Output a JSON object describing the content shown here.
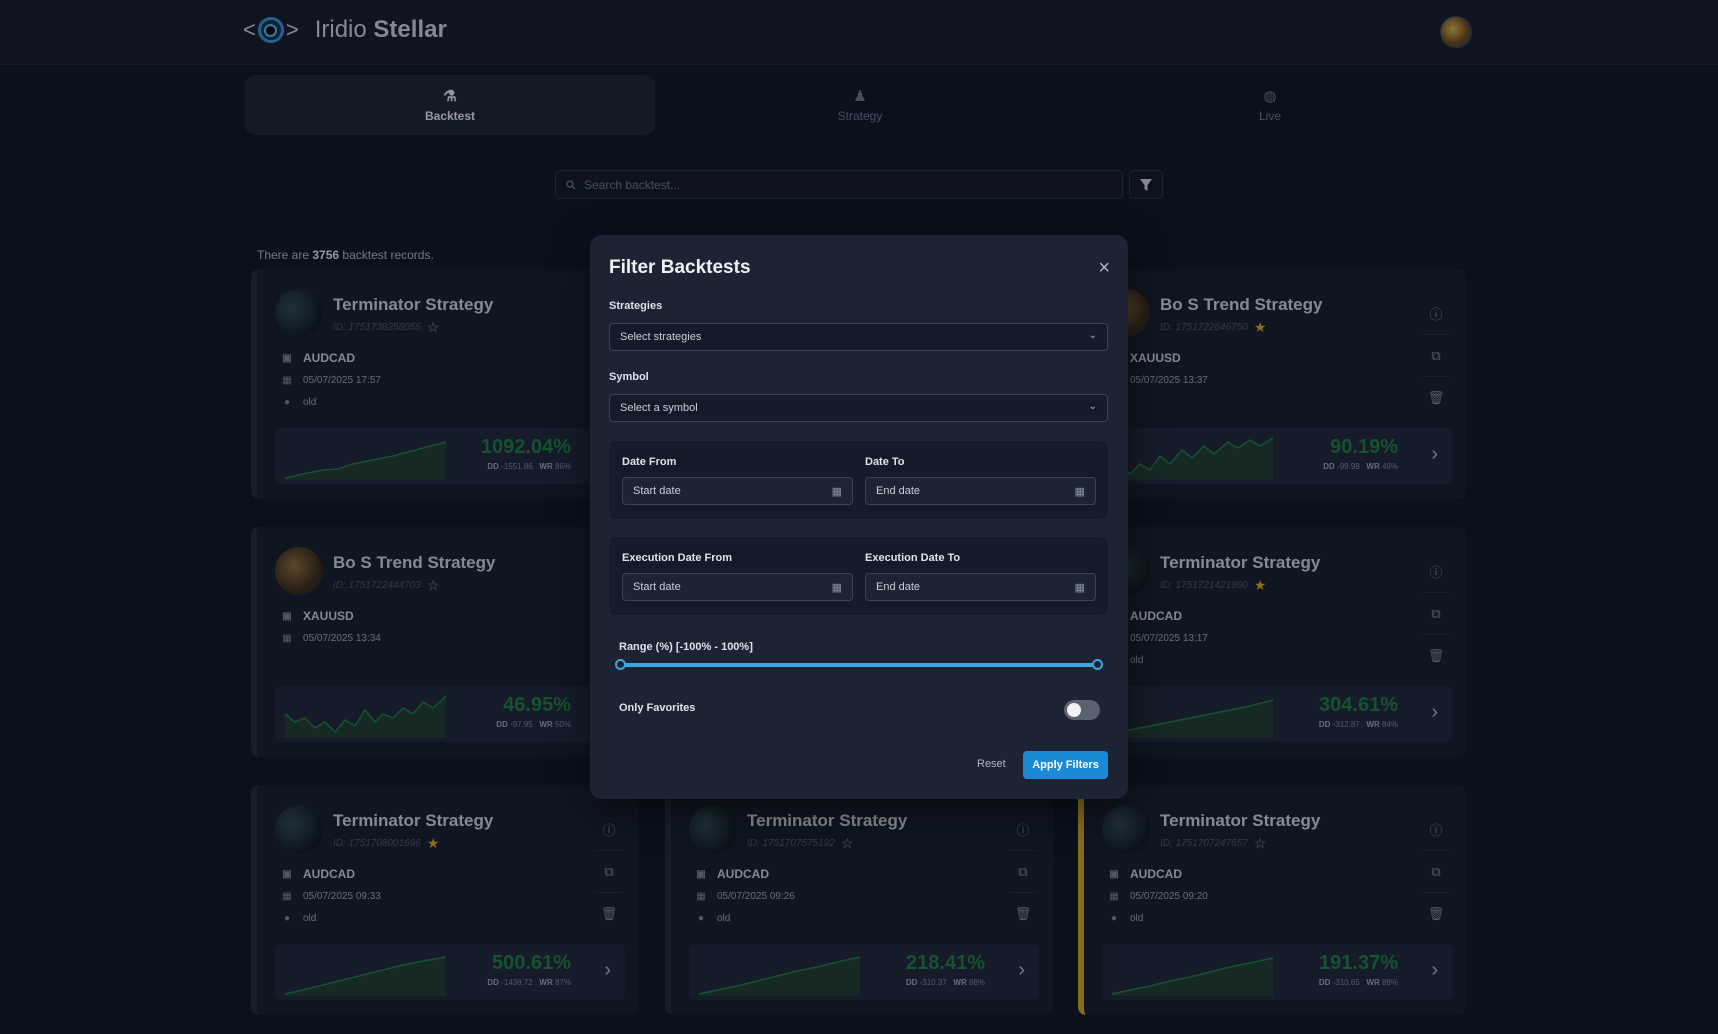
{
  "app": {
    "name_light": "Iridio",
    "name_bold": "Stellar"
  },
  "tabs": [
    {
      "label": "Backtest",
      "icon": "flask-icon",
      "active": true
    },
    {
      "label": "Strategy",
      "icon": "chess-icon",
      "active": false
    },
    {
      "label": "Live",
      "icon": "globe-icon",
      "active": false
    }
  ],
  "search": {
    "placeholder": "Search backtest..."
  },
  "records": {
    "prefix": "There are",
    "count": "3756",
    "suffix": "backtest records."
  },
  "cards": [
    {
      "title": "Terminator Strategy",
      "id": "ID: 1751738258055",
      "favorite": false,
      "symbol": "AUDCAD",
      "date": "05/07/2025 17:57",
      "note": "old",
      "pct": "1092.04%",
      "dd": "-1551.86",
      "wr": "86%"
    },
    {
      "title": "Bo S Trend Strategy",
      "id": "ID: 1751722646750",
      "favorite": true,
      "symbol": "XAUUSD",
      "date": "05/07/2025 13:37",
      "note": "",
      "pct": "90.19%",
      "dd": "-99.98",
      "wr": "49%"
    },
    {
      "title": "Bo S Trend Strategy",
      "id": "ID: 1751722444703",
      "favorite": false,
      "symbol": "XAUUSD",
      "date": "05/07/2025 13:34",
      "note": "",
      "pct": "46.95%",
      "dd": "-97.95",
      "wr": "50%"
    },
    {
      "title": "Terminator Strategy",
      "id": "ID: 1751721421860",
      "favorite": true,
      "symbol": "AUDCAD",
      "date": "05/07/2025 13:17",
      "note": "old",
      "pct": "304.61%",
      "dd": "-312.87",
      "wr": "84%"
    },
    {
      "title": "Terminator Strategy",
      "id": "ID: 1751708001696",
      "favorite": true,
      "symbol": "AUDCAD",
      "date": "05/07/2025 09:33",
      "note": "old",
      "pct": "500.61%",
      "dd": "-1438.72",
      "wr": "87%"
    },
    {
      "title": "Terminator Strategy",
      "id": "ID: 1751707575192",
      "favorite": false,
      "symbol": "AUDCAD",
      "date": "05/07/2025 09:26",
      "note": "old",
      "pct": "218.41%",
      "dd": "-310.37",
      "wr": "88%"
    },
    {
      "title": "Terminator Strategy",
      "id": "ID: 1751707247657",
      "favorite": false,
      "symbol": "AUDCAD",
      "date": "05/07/2025 09:20",
      "note": "old",
      "pct": "191.37%",
      "dd": "-310.65",
      "wr": "88%"
    }
  ],
  "card_labels": {
    "dd": "DD",
    "wr": "WR"
  },
  "modal": {
    "title": "Filter Backtests",
    "strategies_label": "Strategies",
    "strategies_placeholder": "Select strategies",
    "symbol_label": "Symbol",
    "symbol_placeholder": "Select a symbol",
    "date_from_label": "Date From",
    "date_to_label": "Date To",
    "exec_from_label": "Execution Date From",
    "exec_to_label": "Execution Date To",
    "start_date": "Start date",
    "end_date": "End date",
    "range_label": "Range (%) [-100% - 100%]",
    "range_min": -100,
    "range_max": 100,
    "only_favorites_label": "Only Favorites",
    "only_favorites_on": false,
    "reset": "Reset",
    "apply": "Apply Filters"
  },
  "colors": {
    "accent": "#1a8ad4",
    "positive": "#1e7a3e",
    "favorite": "#d7a21d",
    "background": "#0d1422"
  }
}
